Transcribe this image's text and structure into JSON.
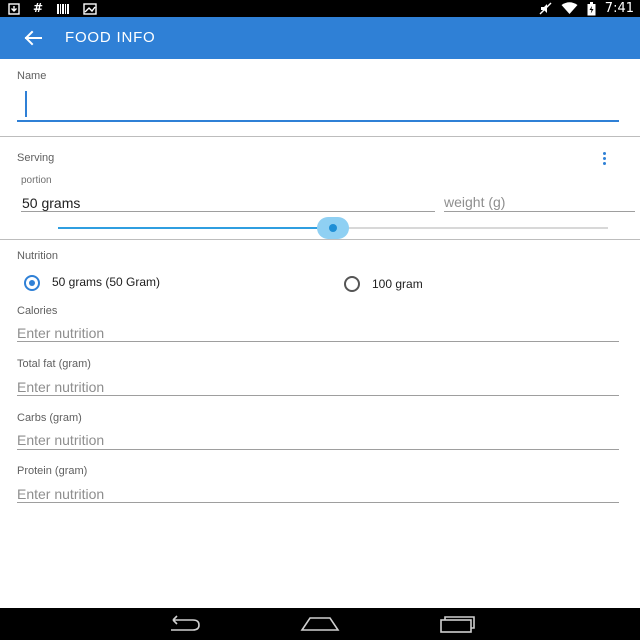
{
  "status_bar": {
    "time": "7:41",
    "left_icons": [
      "download-icon",
      "hash-icon",
      "barcode-icon",
      "image-icon"
    ],
    "right_icons": [
      "mute-icon",
      "wifi-icon",
      "battery-icon"
    ],
    "hash_glyph": "#"
  },
  "app_bar": {
    "title": "FOOD INFO",
    "back_icon": "back-arrow-icon"
  },
  "name_section": {
    "label": "Name",
    "value": ""
  },
  "serving_section": {
    "label": "Serving",
    "portion_label": "portion",
    "portion_value": "50 grams",
    "weight_placeholder": "weight (g)",
    "slider_value_fraction": 0.5
  },
  "nutrition_section": {
    "label": "Nutrition",
    "options": [
      {
        "label": "50 grams (50 Gram)",
        "checked": true
      },
      {
        "label": "100 gram",
        "checked": false
      }
    ],
    "fields": [
      {
        "label": "Calories",
        "placeholder": "Enter nutrition"
      },
      {
        "label": "Total fat (gram)",
        "placeholder": "Enter nutrition"
      },
      {
        "label": "Carbs (gram)",
        "placeholder": "Enter nutrition"
      },
      {
        "label": "Protein (gram)",
        "placeholder": "Enter nutrition"
      }
    ]
  },
  "nav_bar": {
    "buttons": [
      "back-icon",
      "home-icon",
      "recents-icon"
    ]
  },
  "colors": {
    "primary": "#2f80d6",
    "slider_accent": "#2f9ee0",
    "status_bar": "#000000"
  }
}
